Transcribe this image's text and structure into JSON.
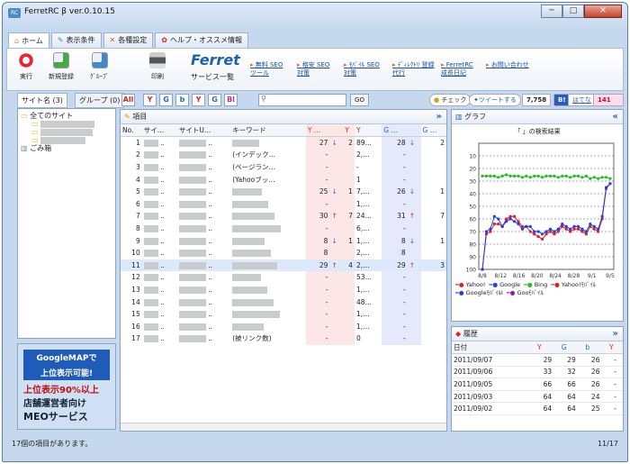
{
  "window": {
    "title": "FerretRC β ver.0.10.15",
    "logo": "RC",
    "min": "─",
    "max": "□",
    "close": "✕"
  },
  "tabs": [
    {
      "label": "ホーム",
      "icon": "home-icon"
    },
    {
      "label": "表示条件",
      "icon": "filter-icon"
    },
    {
      "label": "各種設定",
      "icon": "tools-icon"
    },
    {
      "label": "ヘルプ・オススメ情報",
      "icon": "help-icon"
    }
  ],
  "ribbon": {
    "run": "実行",
    "new_reg": "新規登録",
    "group": "ｸﾞﾙｰﾌﾟ",
    "print": "印刷",
    "brand": "Ferret",
    "brand_sub": "サービス一覧",
    "links": [
      "無料 SEOツール",
      "格安 SEO対策",
      "ﾓﾊﾞｲﾙ SEO対策",
      "ﾃﾞｨﾚｸﾄﾘ 登録代行",
      "FerretRC 成長日記",
      "お問い合わせ"
    ]
  },
  "subtabs": {
    "site": "サイト名 (3)",
    "group": "グループ (0)",
    "all": "All"
  },
  "filters": [
    "Y",
    "G",
    "b",
    "Y",
    "G",
    "Bl"
  ],
  "search": {
    "placeholder": "",
    "go": "GO"
  },
  "social": {
    "check": "チェック",
    "tweet": "ツイートする",
    "count": "7,758",
    "b": "B!",
    "hatena": "はてな",
    "users": "141 users"
  },
  "tree": {
    "root": "全てのサイト",
    "trash": "ごみ箱"
  },
  "ad": {
    "l1": "GoogleMAPで",
    "l2": "上位表示可能!",
    "l3": "上位表示90%以上",
    "l4": "店舗運営者向け",
    "l5": "MEOサービス"
  },
  "items_panel": {
    "title": "項目",
    "more": "»"
  },
  "table": {
    "headers": [
      "No.",
      "サイ…",
      "サイトU…",
      "キーワード",
      "Y …",
      "",
      "Y",
      "Y",
      "G …",
      "",
      "G …"
    ],
    "rows": [
      {
        "no": "1",
        "kw": "",
        "yv": "27",
        "ya": "↓",
        "yd": "2",
        "y3": "89…",
        "gv": "28",
        "ga": "↓",
        "gd": "2"
      },
      {
        "no": "2",
        "kw": "(インデック…",
        "yv": "-",
        "ya": "",
        "yd": "",
        "y3": "2,…",
        "gv": "-",
        "ga": "",
        "gd": ""
      },
      {
        "no": "3",
        "kw": "(ページラン…",
        "yv": "-",
        "ya": "",
        "yd": "",
        "y3": "-",
        "gv": "-",
        "ga": "",
        "gd": ""
      },
      {
        "no": "4",
        "kw": "(Yahooブッ…",
        "yv": "-",
        "ya": "",
        "yd": "",
        "y3": "1",
        "gv": "-",
        "ga": "",
        "gd": ""
      },
      {
        "no": "5",
        "kw": "",
        "yv": "25",
        "ya": "↓",
        "yd": "1",
        "y3": "7,…",
        "gv": "26",
        "ga": "↓",
        "gd": "1"
      },
      {
        "no": "6",
        "kw": "",
        "yv": "-",
        "ya": "",
        "yd": "",
        "y3": "1,…",
        "gv": "-",
        "ga": "",
        "gd": ""
      },
      {
        "no": "7",
        "kw": "",
        "yv": "30",
        "ya": "↑",
        "yd": "7",
        "y3": "24…",
        "gv": "31",
        "ga": "↑",
        "gd": "7"
      },
      {
        "no": "8",
        "kw": "",
        "yv": "-",
        "ya": "",
        "yd": "",
        "y3": "6,…",
        "gv": "-",
        "ga": "",
        "gd": ""
      },
      {
        "no": "9",
        "kw": "",
        "yv": "8",
        "ya": "↓",
        "yd": "1",
        "y3": "1,…",
        "gv": "8",
        "ga": "↓",
        "gd": "1"
      },
      {
        "no": "10",
        "kw": "",
        "yv": "8",
        "ya": "",
        "yd": "",
        "y3": "2,…",
        "gv": "8",
        "ga": "",
        "gd": ""
      },
      {
        "no": "11",
        "kw": "",
        "yv": "29",
        "ya": "↑",
        "yd": "4",
        "y3": "2,…",
        "gv": "29",
        "ga": "↑",
        "gd": "3"
      },
      {
        "no": "12",
        "kw": "",
        "yv": "-",
        "ya": "",
        "yd": "",
        "y3": "53…",
        "gv": "-",
        "ga": "",
        "gd": ""
      },
      {
        "no": "13",
        "kw": "",
        "yv": "-",
        "ya": "",
        "yd": "",
        "y3": "1,…",
        "gv": "-",
        "ga": "",
        "gd": ""
      },
      {
        "no": "14",
        "kw": "",
        "yv": "-",
        "ya": "",
        "yd": "",
        "y3": "48…",
        "gv": "-",
        "ga": "",
        "gd": ""
      },
      {
        "no": "15",
        "kw": "",
        "yv": "-",
        "ya": "",
        "yd": "",
        "y3": "1,…",
        "gv": "-",
        "ga": "",
        "gd": ""
      },
      {
        "no": "16",
        "kw": "",
        "yv": "-",
        "ya": "",
        "yd": "",
        "y3": "1,…",
        "gv": "-",
        "ga": "",
        "gd": ""
      },
      {
        "no": "17",
        "kw": "(被リンク数)",
        "yv": "-",
        "ya": "",
        "yd": "",
        "y3": "0",
        "gv": "-",
        "ga": "",
        "gd": ""
      }
    ]
  },
  "graph": {
    "title": "グラフ",
    "collapse": "«",
    "chart_title": "「        」の検索結果",
    "legend": [
      "Yahoo!",
      "Google",
      "Bing",
      "Yahoo!ﾓﾊﾞｲﾙ",
      "GoogleﾓﾊﾞｲﾙI",
      "Gooﾓﾊﾞｲﾙ"
    ],
    "legend_colors": [
      "#e02020",
      "#2040e0",
      "#20c020",
      "#e02020",
      "#2040e0",
      "#9020a0"
    ]
  },
  "chart_data": {
    "type": "line",
    "ylim": [
      100,
      0
    ],
    "y_ticks": [
      "10",
      "20",
      "30",
      "40",
      "50",
      "60",
      "70",
      "80",
      "90",
      "100"
    ],
    "x_ticks": [
      "8/8",
      "8/12",
      "8/16",
      "8/20",
      "8/24",
      "8/28",
      "9/1",
      "9/5"
    ],
    "series": [
      {
        "name": "Yahoo!",
        "color": "#e02020",
        "values": [
          100,
          72,
          70,
          64,
          64,
          66,
          60,
          58,
          58,
          62,
          66,
          66,
          70,
          72,
          74,
          76,
          72,
          70,
          72,
          70,
          66,
          68,
          70,
          68,
          68,
          70,
          72,
          66,
          68,
          70,
          60,
          36,
          32
        ]
      },
      {
        "name": "Google",
        "color": "#2040e0",
        "values": [
          100,
          70,
          68,
          58,
          60,
          66,
          62,
          60,
          62,
          64,
          68,
          66,
          66,
          70,
          70,
          72,
          70,
          68,
          70,
          68,
          64,
          66,
          68,
          66,
          66,
          68,
          70,
          64,
          66,
          68,
          58,
          35,
          32
        ]
      },
      {
        "name": "Bing",
        "color": "#20c020",
        "values": [
          26,
          26,
          26,
          26,
          27,
          26,
          25,
          26,
          26,
          26,
          27,
          26,
          27,
          26,
          26,
          27,
          26,
          26,
          26,
          27,
          26,
          26,
          27,
          26,
          26,
          27,
          26,
          28,
          27,
          28,
          27,
          27,
          28
        ]
      }
    ]
  },
  "history": {
    "title": "履歴",
    "expand": "»",
    "headers": [
      "日付",
      "Y",
      "G",
      "b",
      "Y"
    ],
    "rows": [
      [
        "2011/09/07",
        "29",
        "29",
        "26",
        "-"
      ],
      [
        "2011/09/06",
        "33",
        "32",
        "26",
        "-"
      ],
      [
        "2011/09/05",
        "66",
        "66",
        "26",
        "-"
      ],
      [
        "2011/09/03",
        "64",
        "64",
        "24",
        "-"
      ],
      [
        "2011/09/02",
        "64",
        "64",
        "25",
        "-"
      ]
    ]
  },
  "status": {
    "left": "17個の項目があります。",
    "right": "11/17"
  }
}
